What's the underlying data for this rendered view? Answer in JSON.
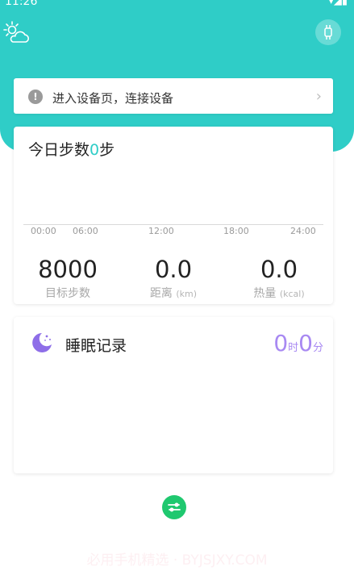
{
  "status_bar": {
    "time": "11:26",
    "icons": "▾◢▮"
  },
  "notice": {
    "text": "进入设备页，连接设备",
    "icon": "exclamation-icon"
  },
  "steps": {
    "title_prefix": "今日步数",
    "count": "0",
    "title_suffix": "步",
    "ticks": [
      "00:00",
      "06:00",
      "12:00",
      "18:00",
      "24:00"
    ],
    "goal_value": "8000",
    "goal_label": "目标步数",
    "distance_value": "0.0",
    "distance_label": "距离",
    "distance_unit": "(km)",
    "calorie_value": "0.0",
    "calorie_label": "热量",
    "calorie_unit": "(kcal)"
  },
  "sleep": {
    "title": "睡眠记录",
    "hours": "0",
    "hours_unit": "时",
    "minutes": "0",
    "minutes_unit": "分"
  },
  "watermark": "必用手机精选 · BYJSJXY.COM",
  "colors": {
    "teal": "#2fcdc7",
    "sleep_accent": "#a889f2",
    "sync_green": "#1fc86f"
  }
}
